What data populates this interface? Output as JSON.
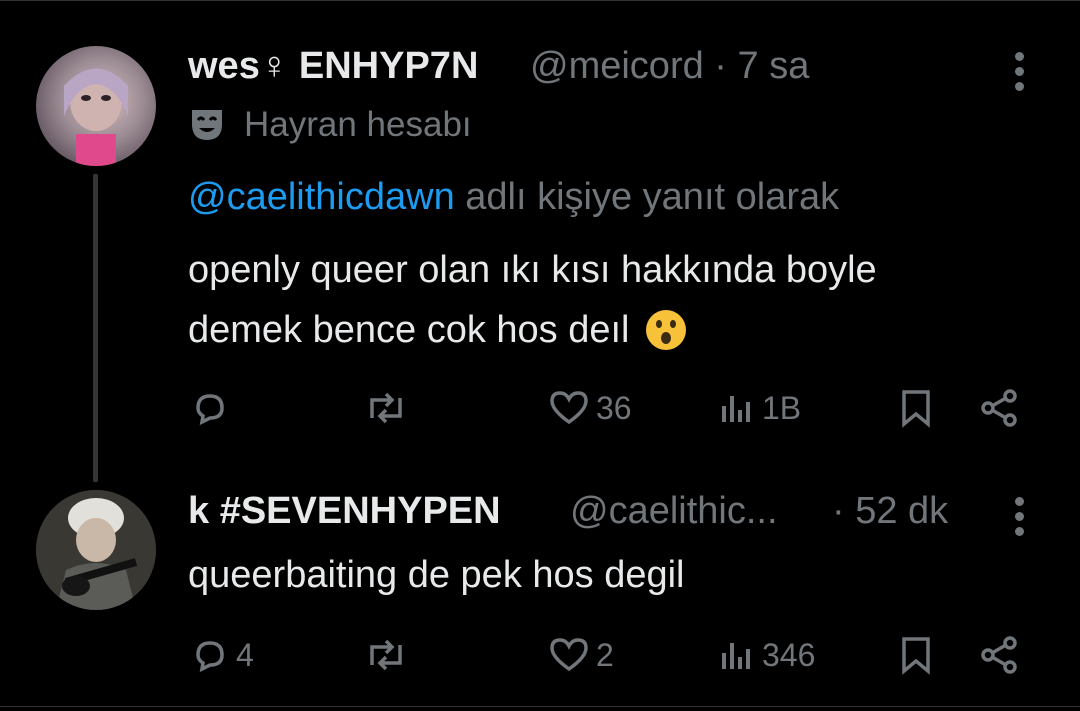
{
  "tweet1": {
    "display_name": "wes♀ ENHYP7N",
    "handle_time": "@meicord · 7 sa",
    "badge": "Hayran hesabı",
    "reply_mention": "@caelithicdawn",
    "reply_suffix": " adlı kişiye yanıt olarak",
    "text_line1": "openly queer olan ıkı kısı hakkında boyle",
    "text_line2": "demek bence cok hos deıl",
    "replies": "",
    "reposts": "",
    "likes": "36",
    "views": "1B"
  },
  "tweet2": {
    "display_name": "k #SEVENHYPEN",
    "handle": "@caelithic...",
    "time": "· 52 dk",
    "text": "queerbaiting de pek hos degil",
    "replies": "4",
    "reposts": "",
    "likes": "2",
    "views": "346"
  },
  "icons": {
    "more": "more-vertical-icon",
    "badge": "theater-mask-icon",
    "emoji": "face-open-mouth-emoji",
    "reply": "reply-bubble-icon",
    "repost": "repost-icon",
    "like": "heart-icon",
    "views": "analytics-bars-icon",
    "bookmark": "bookmark-icon",
    "share": "share-icon"
  },
  "colors": {
    "background": "#000000",
    "text": "#e7e9ea",
    "muted": "#71767b",
    "link": "#1d9bf0"
  }
}
